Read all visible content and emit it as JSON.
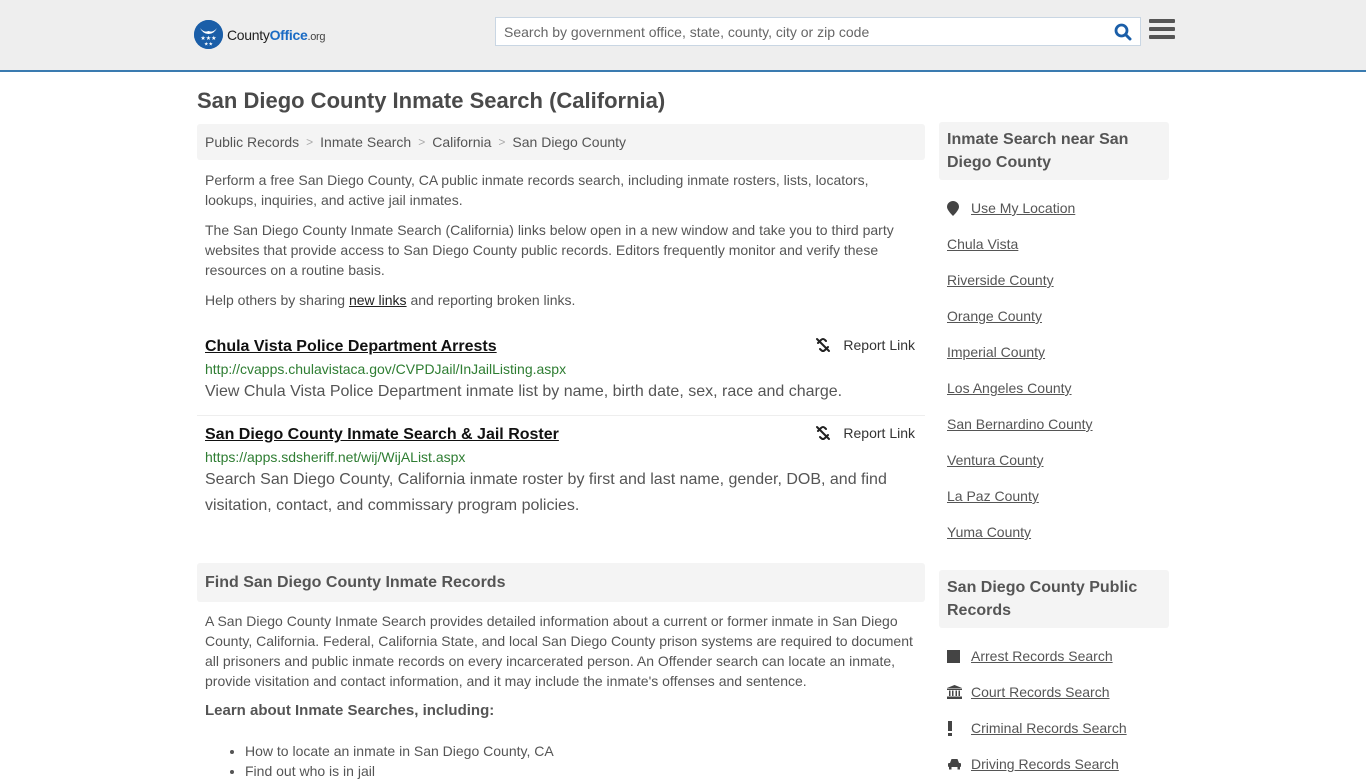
{
  "header": {
    "logo": {
      "name": "County",
      "name_accent": "Office",
      "suffix": ".org"
    },
    "search": {
      "placeholder": "Search by government office, state, county, city or zip code",
      "value": ""
    }
  },
  "page": {
    "title": "San Diego County Inmate Search (California)",
    "breadcrumb": [
      "Public Records",
      "Inmate Search",
      "California",
      "San Diego County"
    ],
    "intro": {
      "p1": "Perform a free San Diego County, CA public inmate records search, including inmate rosters, lists, locators, lookups, inquiries, and active jail inmates.",
      "p2": "The San Diego County Inmate Search (California) links below open in a new window and take you to third party websites that provide access to San Diego County public records. Editors frequently monitor and verify these resources on a routine basis.",
      "p3_before": "Help others by sharing ",
      "p3_link": "new links",
      "p3_after": " and reporting broken links."
    },
    "results": [
      {
        "title": "Chula Vista Police Department Arrests",
        "url": "http://cvapps.chulavistaca.gov/CVPDJail/InJailListing.aspx",
        "description": "View Chula Vista Police Department inmate list by name, birth date, sex, race and charge.",
        "report_label": "Report Link"
      },
      {
        "title": "San Diego County Inmate Search & Jail Roster",
        "url": "https://apps.sdsheriff.net/wij/WijAList.aspx",
        "description": "Search San Diego County, California inmate roster by first and last name, gender, DOB, and find visitation, contact, and commissary program policies.",
        "report_label": "Report Link"
      }
    ],
    "find_section": {
      "heading": "Find San Diego County Inmate Records",
      "body": "A San Diego County Inmate Search provides detailed information about a current or former inmate in San Diego County, California. Federal, California State, and local San Diego County prison systems are required to document all prisoners and public inmate records on every incarcerated person. An Offender search can locate an inmate, provide visitation and contact information, and it may include the inmate's offenses and sentence.",
      "learn_heading": "Learn about Inmate Searches, including:",
      "bullets": [
        "How to locate an inmate in San Diego County, CA",
        "Find out who is in jail"
      ]
    }
  },
  "sidebar": {
    "nearby": {
      "heading": "Inmate Search near San Diego County",
      "use_location": "Use My Location",
      "links": [
        "Chula Vista",
        "Riverside County",
        "Orange County",
        "Imperial County",
        "Los Angeles County",
        "San Bernardino County",
        "Ventura County",
        "La Paz County",
        "Yuma County"
      ]
    },
    "public_records": {
      "heading": "San Diego County Public Records",
      "links": [
        {
          "label": "Arrest Records Search",
          "icon": "square-icon"
        },
        {
          "label": "Court Records Search",
          "icon": "courthouse-icon"
        },
        {
          "label": "Criminal Records Search",
          "icon": "exclamation-icon"
        },
        {
          "label": "Driving Records Search",
          "icon": "car-icon"
        }
      ]
    }
  }
}
